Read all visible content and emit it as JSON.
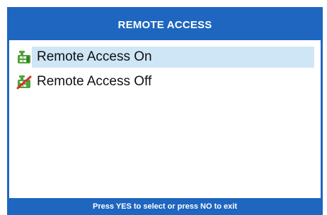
{
  "window": {
    "title": "REMOTE ACCESS"
  },
  "menu": {
    "items": [
      {
        "label": "Remote Access On",
        "icon": "phone-on-icon",
        "selected": true
      },
      {
        "label": "Remote Access Off",
        "icon": "phone-off-icon",
        "selected": false
      }
    ]
  },
  "footer": {
    "instruction": "Press YES to select or press NO to exit"
  },
  "colors": {
    "accent": "#1e66bf",
    "selection": "#cfe6f7",
    "icon_green": "#4ea33a",
    "icon_red": "#d6312a"
  }
}
